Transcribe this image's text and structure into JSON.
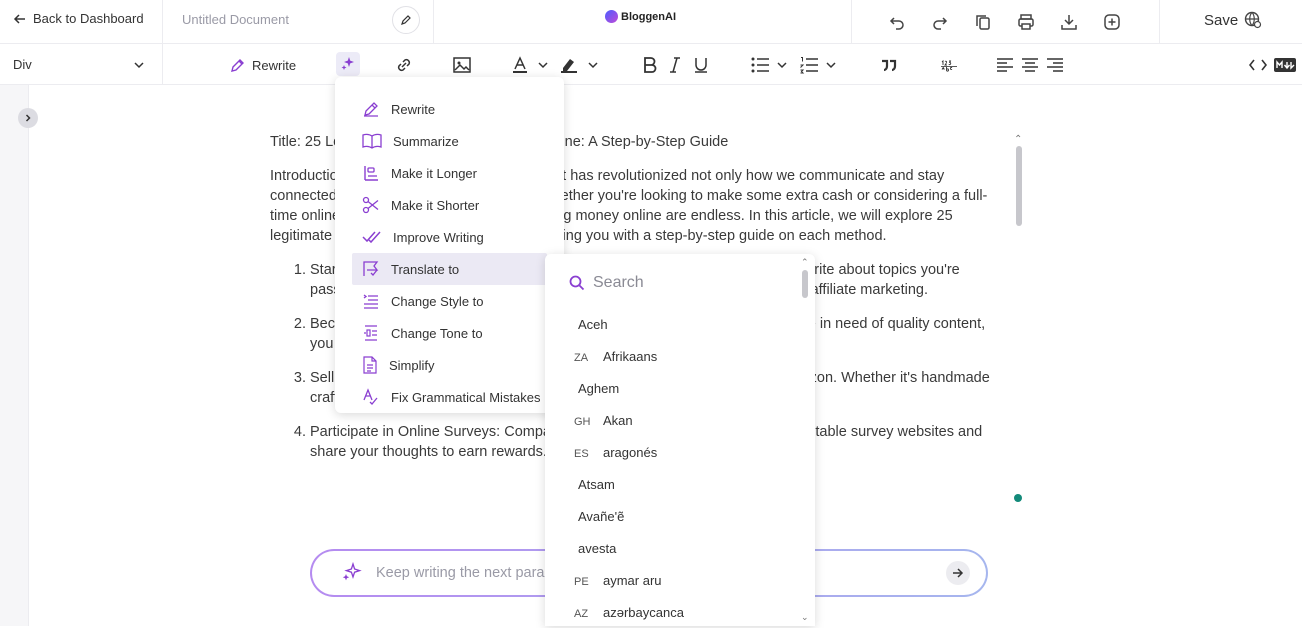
{
  "header": {
    "back_label": "Back to Dashboard",
    "doc_title_placeholder": "Untitled Document",
    "logo_text": "BloggenAI",
    "save_label": "Save"
  },
  "toolbar": {
    "block_type": "Div",
    "rewrite_label": "Rewrite"
  },
  "ai_menu": {
    "items": [
      {
        "label": "Rewrite",
        "icon": "pencil-icon"
      },
      {
        "label": "Summarize",
        "icon": "book-icon"
      },
      {
        "label": "Make it Longer",
        "icon": "align-lengthen-icon"
      },
      {
        "label": "Make it Shorter",
        "icon": "scissors-icon"
      },
      {
        "label": "Improve Writing",
        "icon": "double-check-icon"
      },
      {
        "label": "Translate to",
        "icon": "translate-icon"
      },
      {
        "label": "Change Style to",
        "icon": "style-icon"
      },
      {
        "label": "Change Tone to",
        "icon": "tone-icon"
      },
      {
        "label": "Simplify",
        "icon": "document-icon"
      },
      {
        "label": "Fix Grammatical Mistakes",
        "icon": "grammar-icon"
      }
    ],
    "active_index": 5
  },
  "language_panel": {
    "search_placeholder": "Search",
    "languages": [
      {
        "code": "",
        "name": "Aceh"
      },
      {
        "code": "ZA",
        "name": "Afrikaans"
      },
      {
        "code": "",
        "name": "Aghem"
      },
      {
        "code": "GH",
        "name": "Akan"
      },
      {
        "code": "ES",
        "name": "aragonés"
      },
      {
        "code": "",
        "name": "Atsam"
      },
      {
        "code": "",
        "name": "Avañe'ẽ"
      },
      {
        "code": "",
        "name": "avesta"
      },
      {
        "code": "PE",
        "name": "aymar aru"
      },
      {
        "code": "AZ",
        "name": "azərbaycanca"
      }
    ]
  },
  "content": {
    "title_line": "Title: 25 Legitimate Ways to Make Money Online: A Step-by-Step Guide",
    "intro": "Introduction: In today's digital age, the internet has revolutionized not only how we communicate and stay connected but also how we make money. Whether you're looking to make some extra cash or considering a full-time online career, the opportunities for making money online are endless. In this article, we will explore 25 legitimate ways to make money online, providing you with a step-by-step guide on each method.",
    "list": [
      "Start a Blog: Blogging can be a fun and creative way to make money online. Write about topics you're passionate about, and monetize your blog through ads, sponsored posts, and affiliate marketing.",
      "Become a Freelance Writer: With more and more businesses and websites are in need of quality content, you can offer your writing services to attract clients.",
      "Sell Products Online: Sell your products on popular platforms like Etsy or Amazon. Whether it's handmade crafts or vintage items, selling online can be profitable.",
      "Participate in Online Surveys: Companies want your opinion. Sign up with reputable survey websites and share your thoughts to earn rewards."
    ]
  },
  "composer": {
    "placeholder": "Keep writing the next paragraph..."
  },
  "colors": {
    "accent": "#8a3fd1",
    "teal_dot": "#138a7a"
  }
}
